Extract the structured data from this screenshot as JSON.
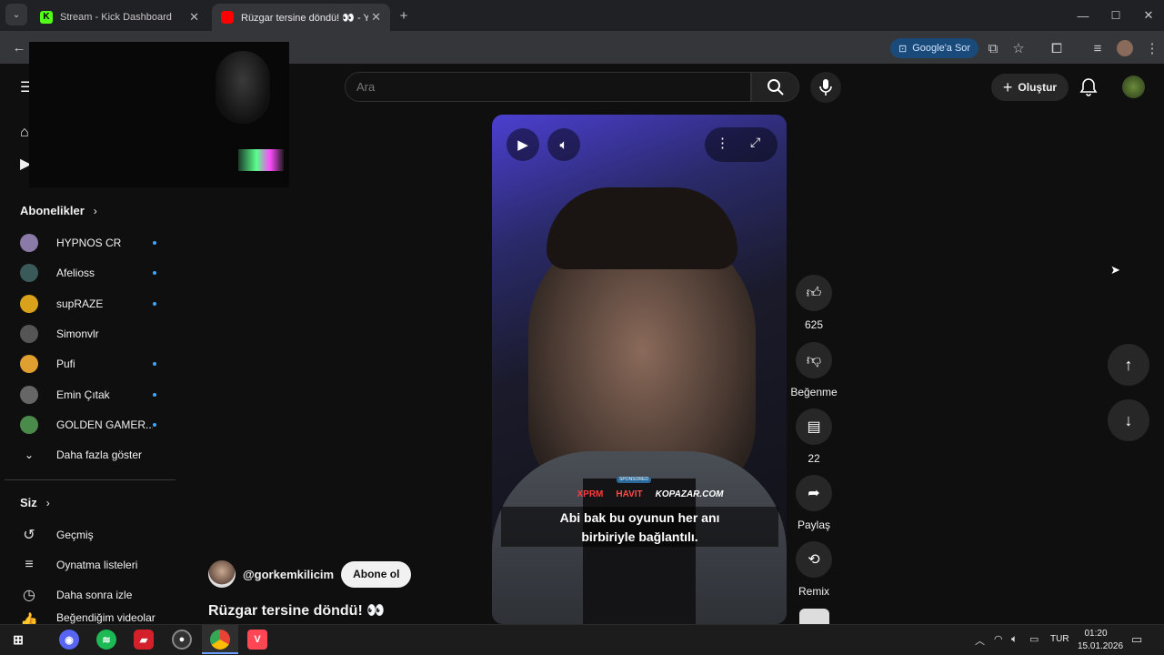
{
  "browser": {
    "tabs": [
      {
        "label": "Stream - Kick Dashboard"
      },
      {
        "label": "Rüzgar tersine döndü! 👀 - You"
      }
    ],
    "google_ask": "Google'a Sor"
  },
  "youtube": {
    "search": {
      "placeholder": "Ara"
    },
    "create_label": "Oluştur",
    "subscriptions_title": "Abonelikler",
    "subscriptions": [
      {
        "name": "HYPNOS CR",
        "color": "#8a7aa8",
        "live_dot": true
      },
      {
        "name": "Afelioss",
        "color": "#3a5a5a",
        "live_dot": true
      },
      {
        "name": "supRAZE",
        "color": "#d9a21a",
        "live_dot": true
      },
      {
        "name": "Simonvlr",
        "color": "#555555",
        "live_dot": false
      },
      {
        "name": "Pufi",
        "color": "#e0a030",
        "live_dot": true
      },
      {
        "name": "Emin Çıtak",
        "color": "#666666",
        "live_dot": true
      },
      {
        "name": "GOLDEN GAMER...",
        "color": "#4a8a4a",
        "live_dot": true
      }
    ],
    "show_more": "Daha fazla göster",
    "you_title": "Siz",
    "library": [
      {
        "label": "Geçmiş",
        "icon": "history-icon"
      },
      {
        "label": "Oynatma listeleri",
        "icon": "playlist-icon"
      },
      {
        "label": "Daha sonra izle",
        "icon": "clock-icon"
      },
      {
        "label": "Beğendiğim videolar",
        "icon": "like-icon"
      }
    ],
    "video": {
      "sponsors": [
        "XPRM",
        "HAVIT",
        "KOPAZAR.COM"
      ],
      "sponsor_tag": "SPONSORED",
      "caption_line1": "Abi bak bu oyunun her anı",
      "caption_line2": "birbiriyle bağlantılı."
    },
    "actions": {
      "likes": "625",
      "dislike_label": "Beğenme",
      "comments": "22",
      "share_label": "Paylaş",
      "remix_label": "Remix"
    },
    "channel": {
      "handle": "@gorkemkilicim",
      "subscribe_label": "Abone ol"
    },
    "title": "Rüzgar tersine döndü! 👀"
  },
  "taskbar": {
    "language": "TUR",
    "time": "01:20",
    "date": "15.01.2026"
  }
}
